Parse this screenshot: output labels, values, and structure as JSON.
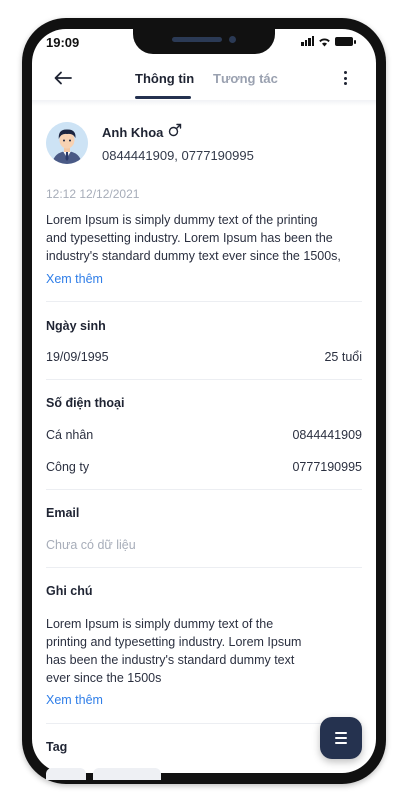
{
  "status_bar": {
    "time": "19:09"
  },
  "header": {
    "tabs": [
      {
        "label": "Thông tin",
        "active": true
      },
      {
        "label": "Tương tác",
        "active": false
      }
    ]
  },
  "profile": {
    "name": "Anh Khoa",
    "gender": "male",
    "phones": "0844441909, 0777190995"
  },
  "post": {
    "timestamp": "12:12 12/12/2021",
    "text_lines": [
      "Lorem Ipsum is simply dummy text of the printing",
      "and typesetting industry. Lorem Ipsum has been the",
      "industry's standard dummy text ever since the 1500s,"
    ],
    "see_more": "Xem thêm"
  },
  "birthday": {
    "title": "Ngày sinh",
    "date": "19/09/1995",
    "age": "25 tuổi"
  },
  "phone_section": {
    "title": "Số điện thoại",
    "rows": [
      {
        "label": "Cá nhân",
        "value": "0844441909"
      },
      {
        "label": "Công ty",
        "value": "0777190995"
      }
    ]
  },
  "email": {
    "title": "Email",
    "empty_text": "Chưa có dữ liệu"
  },
  "note": {
    "title": "Ghi chú",
    "text_lines": [
      "Lorem Ipsum is simply dummy text of the",
      "printing and typesetting industry. Lorem Ipsum",
      "has been the industry's standard dummy text",
      "ever since the 1500s"
    ],
    "see_more": "Xem thêm"
  },
  "tag": {
    "title": "Tag"
  },
  "colors": {
    "accent_link": "#2f7ee8",
    "primary_dark": "#25324f",
    "muted_text": "#a7adb9"
  },
  "icons": {
    "back": "arrow-left-icon",
    "more": "more-vertical-icon",
    "gender": "male-icon",
    "fab": "menu-icon"
  }
}
